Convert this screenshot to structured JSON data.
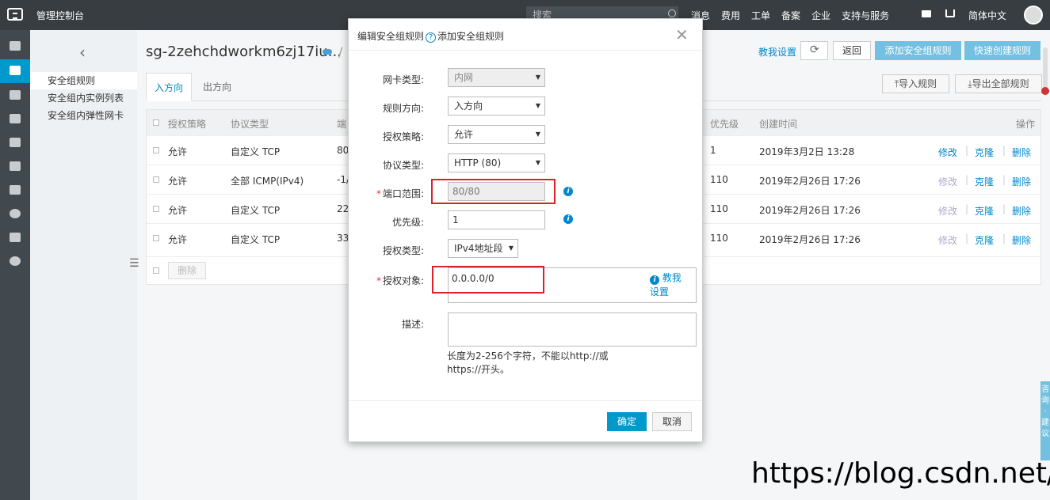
{
  "topbar": {
    "brand": "管理控制台",
    "search_placeholder": "搜索",
    "nav": [
      "消息",
      "费用",
      "工单",
      "备案",
      "企业",
      "支持与服务"
    ],
    "lang": "简体中文"
  },
  "sidebar": {
    "items": [
      "安全组规则",
      "安全组内实例列表",
      "安全组内弹性网卡"
    ]
  },
  "header": {
    "title": "sg-2zehchdworkm6zj17iu...",
    "slash": "/",
    "help_link": "教我设置",
    "back_label": "返回",
    "add_rule_label": "添加安全组规则",
    "quick_rule_label": "快速创建规则"
  },
  "tabs": [
    "入方向",
    "出方向"
  ],
  "toolbar": {
    "import_label": "导入规则",
    "export_label": "导出全部规则"
  },
  "table": {
    "headers": {
      "policy": "授权策略",
      "protocol": "协议类型",
      "port": "端",
      "priority": "优先级",
      "created": "创建时间",
      "ops": "操作"
    },
    "rows": [
      {
        "policy": "允许",
        "protocol": "自定义 TCP",
        "port": "80,",
        "priority": "1",
        "created": "2019年3月2日 13:28",
        "edit": "修改",
        "clone": "克隆",
        "delete": "删除"
      },
      {
        "policy": "允许",
        "protocol": "全部 ICMP(IPv4)",
        "port": "-1/",
        "priority": "110",
        "created": "2019年2月26日 17:26",
        "edit": "修改",
        "clone": "克隆",
        "delete": "删除"
      },
      {
        "policy": "允许",
        "protocol": "自定义 TCP",
        "port": "22/",
        "priority": "110",
        "created": "2019年2月26日 17:26",
        "edit": "修改",
        "clone": "克隆",
        "delete": "删除"
      },
      {
        "policy": "允许",
        "protocol": "自定义 TCP",
        "port": "33",
        "priority": "110",
        "created": "2019年2月26日 17:26",
        "edit": "修改",
        "clone": "克隆",
        "delete": "删除"
      }
    ],
    "delete_label": "删除"
  },
  "modal": {
    "title_edit": "编辑安全组规则",
    "title_add": "添加安全组规则",
    "fields": {
      "nic_type_label": "网卡类型:",
      "nic_type_value": "内网",
      "direction_label": "规则方向:",
      "direction_value": "入方向",
      "policy_label": "授权策略:",
      "policy_value": "允许",
      "protocol_label": "协议类型:",
      "protocol_value": "HTTP (80)",
      "port_label": "端口范围:",
      "port_value": "80/80",
      "priority_label": "优先级:",
      "priority_value": "1",
      "auth_type_label": "授权类型:",
      "auth_type_value": "IPv4地址段",
      "auth_obj_label": "授权对象:",
      "auth_obj_value": "0.0.0.0/0",
      "auth_help_1": "教我",
      "auth_help_2": "设置",
      "desc_label": "描述:",
      "hint": "长度为2-256个字符，不能以http://或https://开头。"
    },
    "ok_label": "确定",
    "cancel_label": "取消"
  },
  "feedback": "咨询·建议",
  "watermark": "https://blog.csdn.net/"
}
